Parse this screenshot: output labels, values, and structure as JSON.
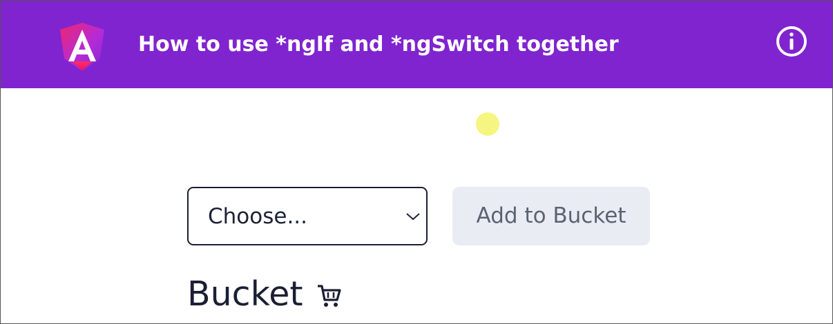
{
  "header": {
    "title": "How to use *ngIf and *ngSwitch together",
    "logo_icon": "angular-logo",
    "info_icon": "info-icon",
    "background_color": "#8024cf"
  },
  "form": {
    "select": {
      "selected_value": "Choose..."
    },
    "add_button_label": "Add to Bucket"
  },
  "bucket": {
    "heading": "Bucket",
    "icon": "cart-icon"
  }
}
